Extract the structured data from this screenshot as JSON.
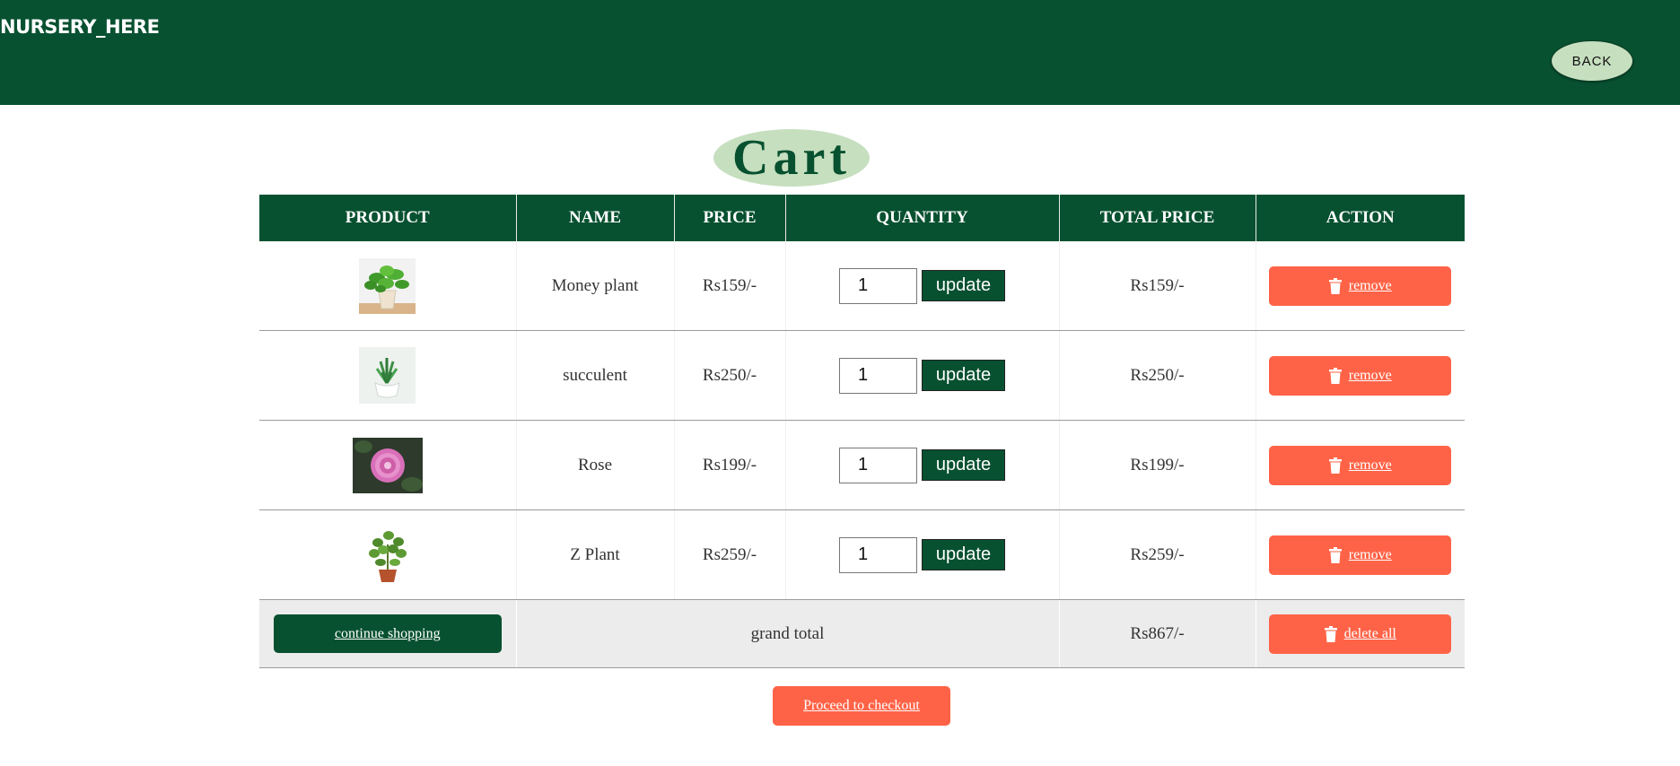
{
  "header": {
    "brand": "NURSERY_HERE",
    "back_label": "BACK"
  },
  "page": {
    "title": "Cart"
  },
  "colors": {
    "primary": "#075130",
    "accent": "#ff6347",
    "light_green": "#c6dfbf"
  },
  "table": {
    "headers": [
      "PRODUCT",
      "NAME",
      "PRICE",
      "QUANTITY",
      "TOTAL PRICE",
      "ACTION"
    ],
    "rows": [
      {
        "image": "money-plant-image",
        "name": "Money plant",
        "price": "Rs159/-",
        "quantity": "1",
        "update_label": "update",
        "total": "Rs159/-",
        "action_label": "remove"
      },
      {
        "image": "succulent-image",
        "name": "succulent",
        "price": "Rs250/-",
        "quantity": "1",
        "update_label": "update",
        "total": "Rs250/-",
        "action_label": "remove"
      },
      {
        "image": "rose-image",
        "name": "Rose",
        "price": "Rs199/-",
        "quantity": "1",
        "update_label": "update",
        "total": "Rs199/-",
        "action_label": "remove"
      },
      {
        "image": "z-plant-image",
        "name": "Z Plant",
        "price": "Rs259/-",
        "quantity": "1",
        "update_label": "update",
        "total": "Rs259/-",
        "action_label": "remove"
      }
    ],
    "footer": {
      "continue_label": "continue shopping",
      "grand_total_label": "grand total",
      "grand_total": "Rs867/-",
      "delete_all_label": "delete all"
    }
  },
  "checkout_label": "Proceed to checkout"
}
